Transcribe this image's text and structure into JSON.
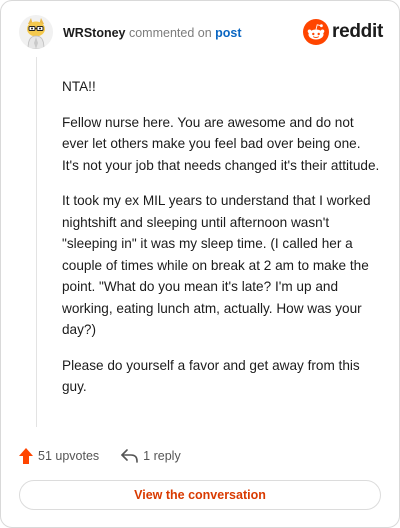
{
  "comment": {
    "username": "WRStoney",
    "action_text": "commented on",
    "post_link_text": "post",
    "paragraphs": [
      "NTA!!",
      "Fellow nurse here. You are awesome and do not ever let others make you feel bad over being one. It's not your job that needs changed it's their attitude.",
      "It took my ex MIL years to understand that I worked nightshift and sleeping until afternoon wasn't \"sleeping in\" it was my sleep time. (I called her a couple of times while on break at 2 am to make the point. \"What do you mean it's late? I'm up and working, eating lunch atm, actually. How was your day?)",
      "Please do yourself a favor and get away from this guy."
    ],
    "upvotes": "51 upvotes",
    "replies": "1 reply"
  },
  "brand": {
    "name": "reddit",
    "color": "#ff4500"
  },
  "actions": {
    "view_conversation": "View the conversation"
  },
  "icons": {
    "avatar": "snoo-avatar-icon",
    "logo": "reddit-alien-icon",
    "upvote": "upvote-arrow-icon",
    "reply": "reply-arrow-icon"
  },
  "colors": {
    "upvote": "#ff4500",
    "link": "#0a66c2",
    "cta_text": "#d93a00"
  }
}
